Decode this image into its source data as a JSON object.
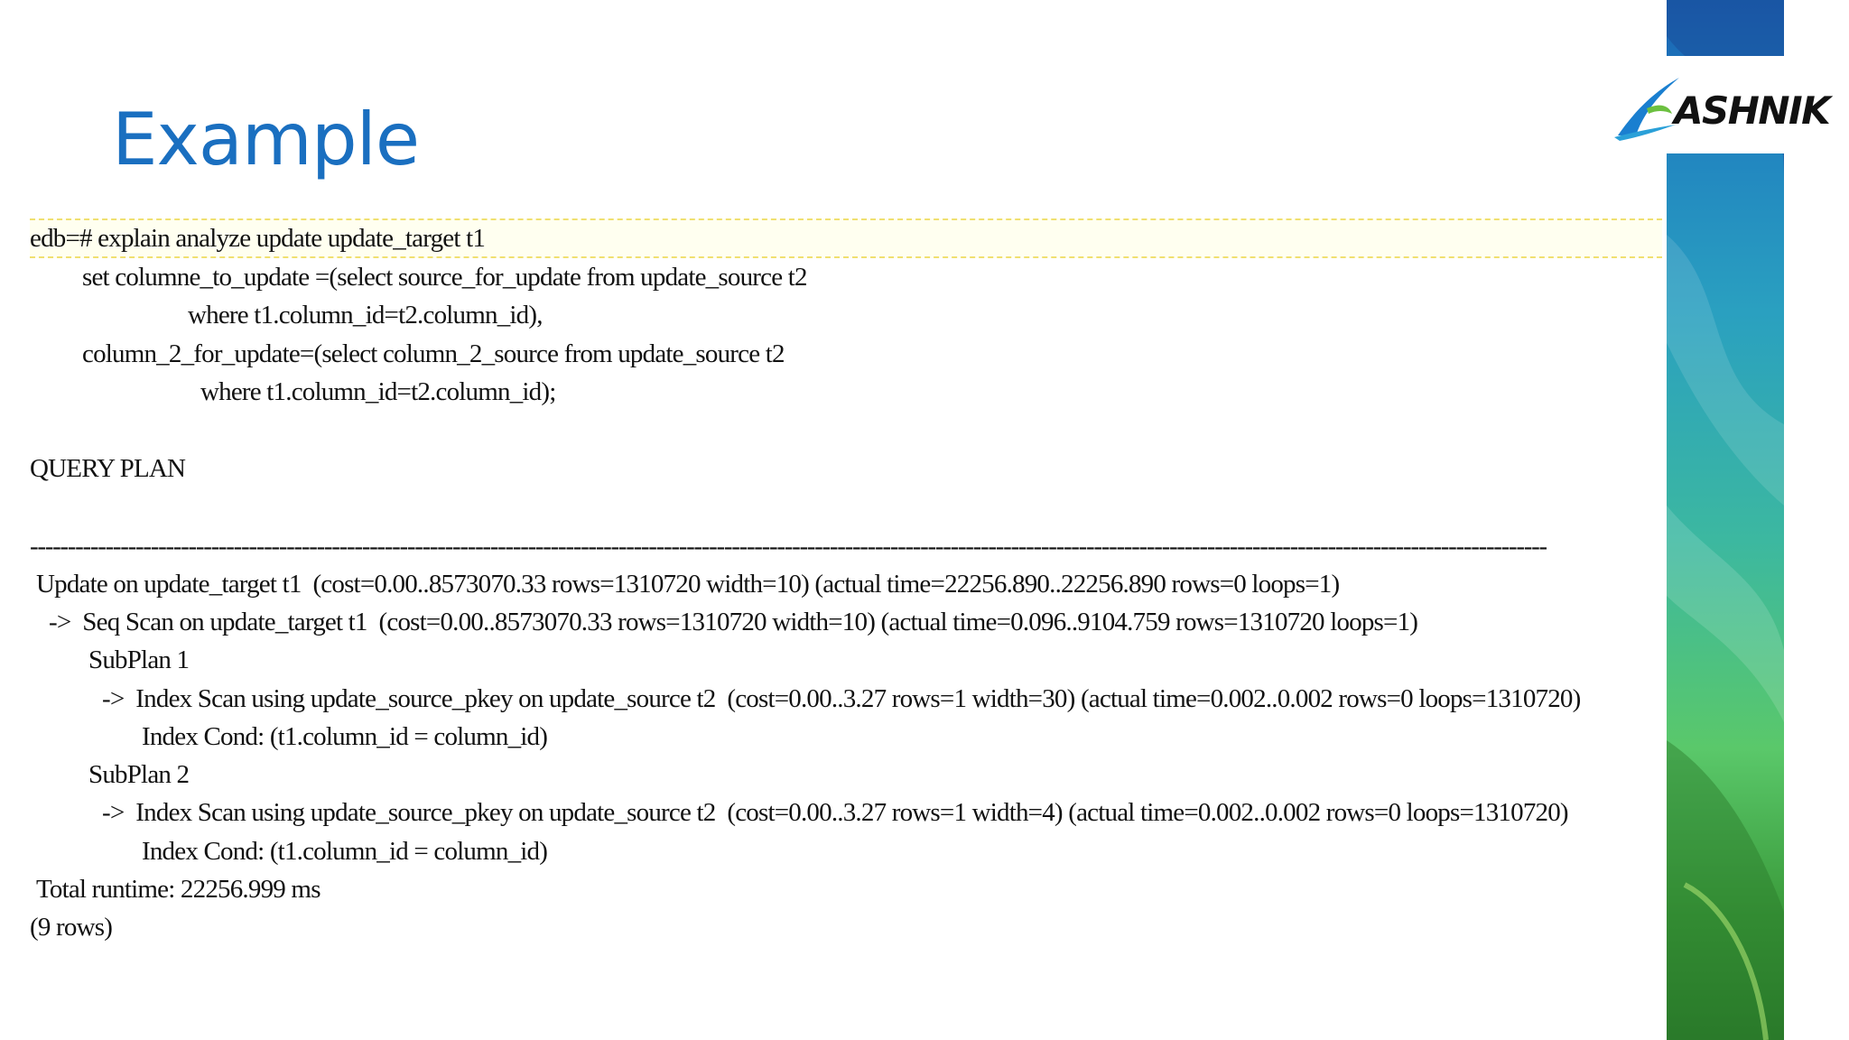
{
  "slide": {
    "title": "Example"
  },
  "brand": {
    "logo_text": "ASHNIK",
    "logo_icon": "swoosh-logo-icon",
    "colors": {
      "title": "#1a6fc0",
      "stripe_top": "#1a5fb0",
      "stripe_bottom": "#2a7a2a",
      "logo_swoosh": "#1a7fd0"
    }
  },
  "query": {
    "lines": [
      "edb=# explain analyze update update_target t1",
      "set columne_to_update =(select source_for_update from update_source t2",
      "where t1.column_id=t2.column_id),",
      "column_2_for_update=(select column_2_source from update_source t2",
      "where t1.column_id=t2.column_id);"
    ]
  },
  "plan": {
    "header": "QUERY PLAN",
    "separator": "------------------------------------------------------------------------------------------------------------------------------------------------------------------------------------------------------------------------------------------------------",
    "lines": [
      "Update on update_target t1  (cost=0.00..8573070.33 rows=1310720 width=10) (actual time=22256.890..22256.890 rows=0 loops=1)",
      "->  Seq Scan on update_target t1  (cost=0.00..8573070.33 rows=1310720 width=10) (actual time=0.096..9104.759 rows=1310720 loops=1)",
      "SubPlan 1",
      "->  Index Scan using update_source_pkey on update_source t2  (cost=0.00..3.27 rows=1 width=30) (actual time=0.002..0.002 rows=0 loops=1310720)",
      "Index Cond: (t1.column_id = column_id)",
      "SubPlan 2",
      "->  Index Scan using update_source_pkey on update_source t2  (cost=0.00..3.27 rows=1 width=4) (actual time=0.002..0.002 rows=0 loops=1310720)",
      "Index Cond: (t1.column_id = column_id)",
      "Total runtime: 22256.999 ms",
      "(9 rows)"
    ]
  }
}
